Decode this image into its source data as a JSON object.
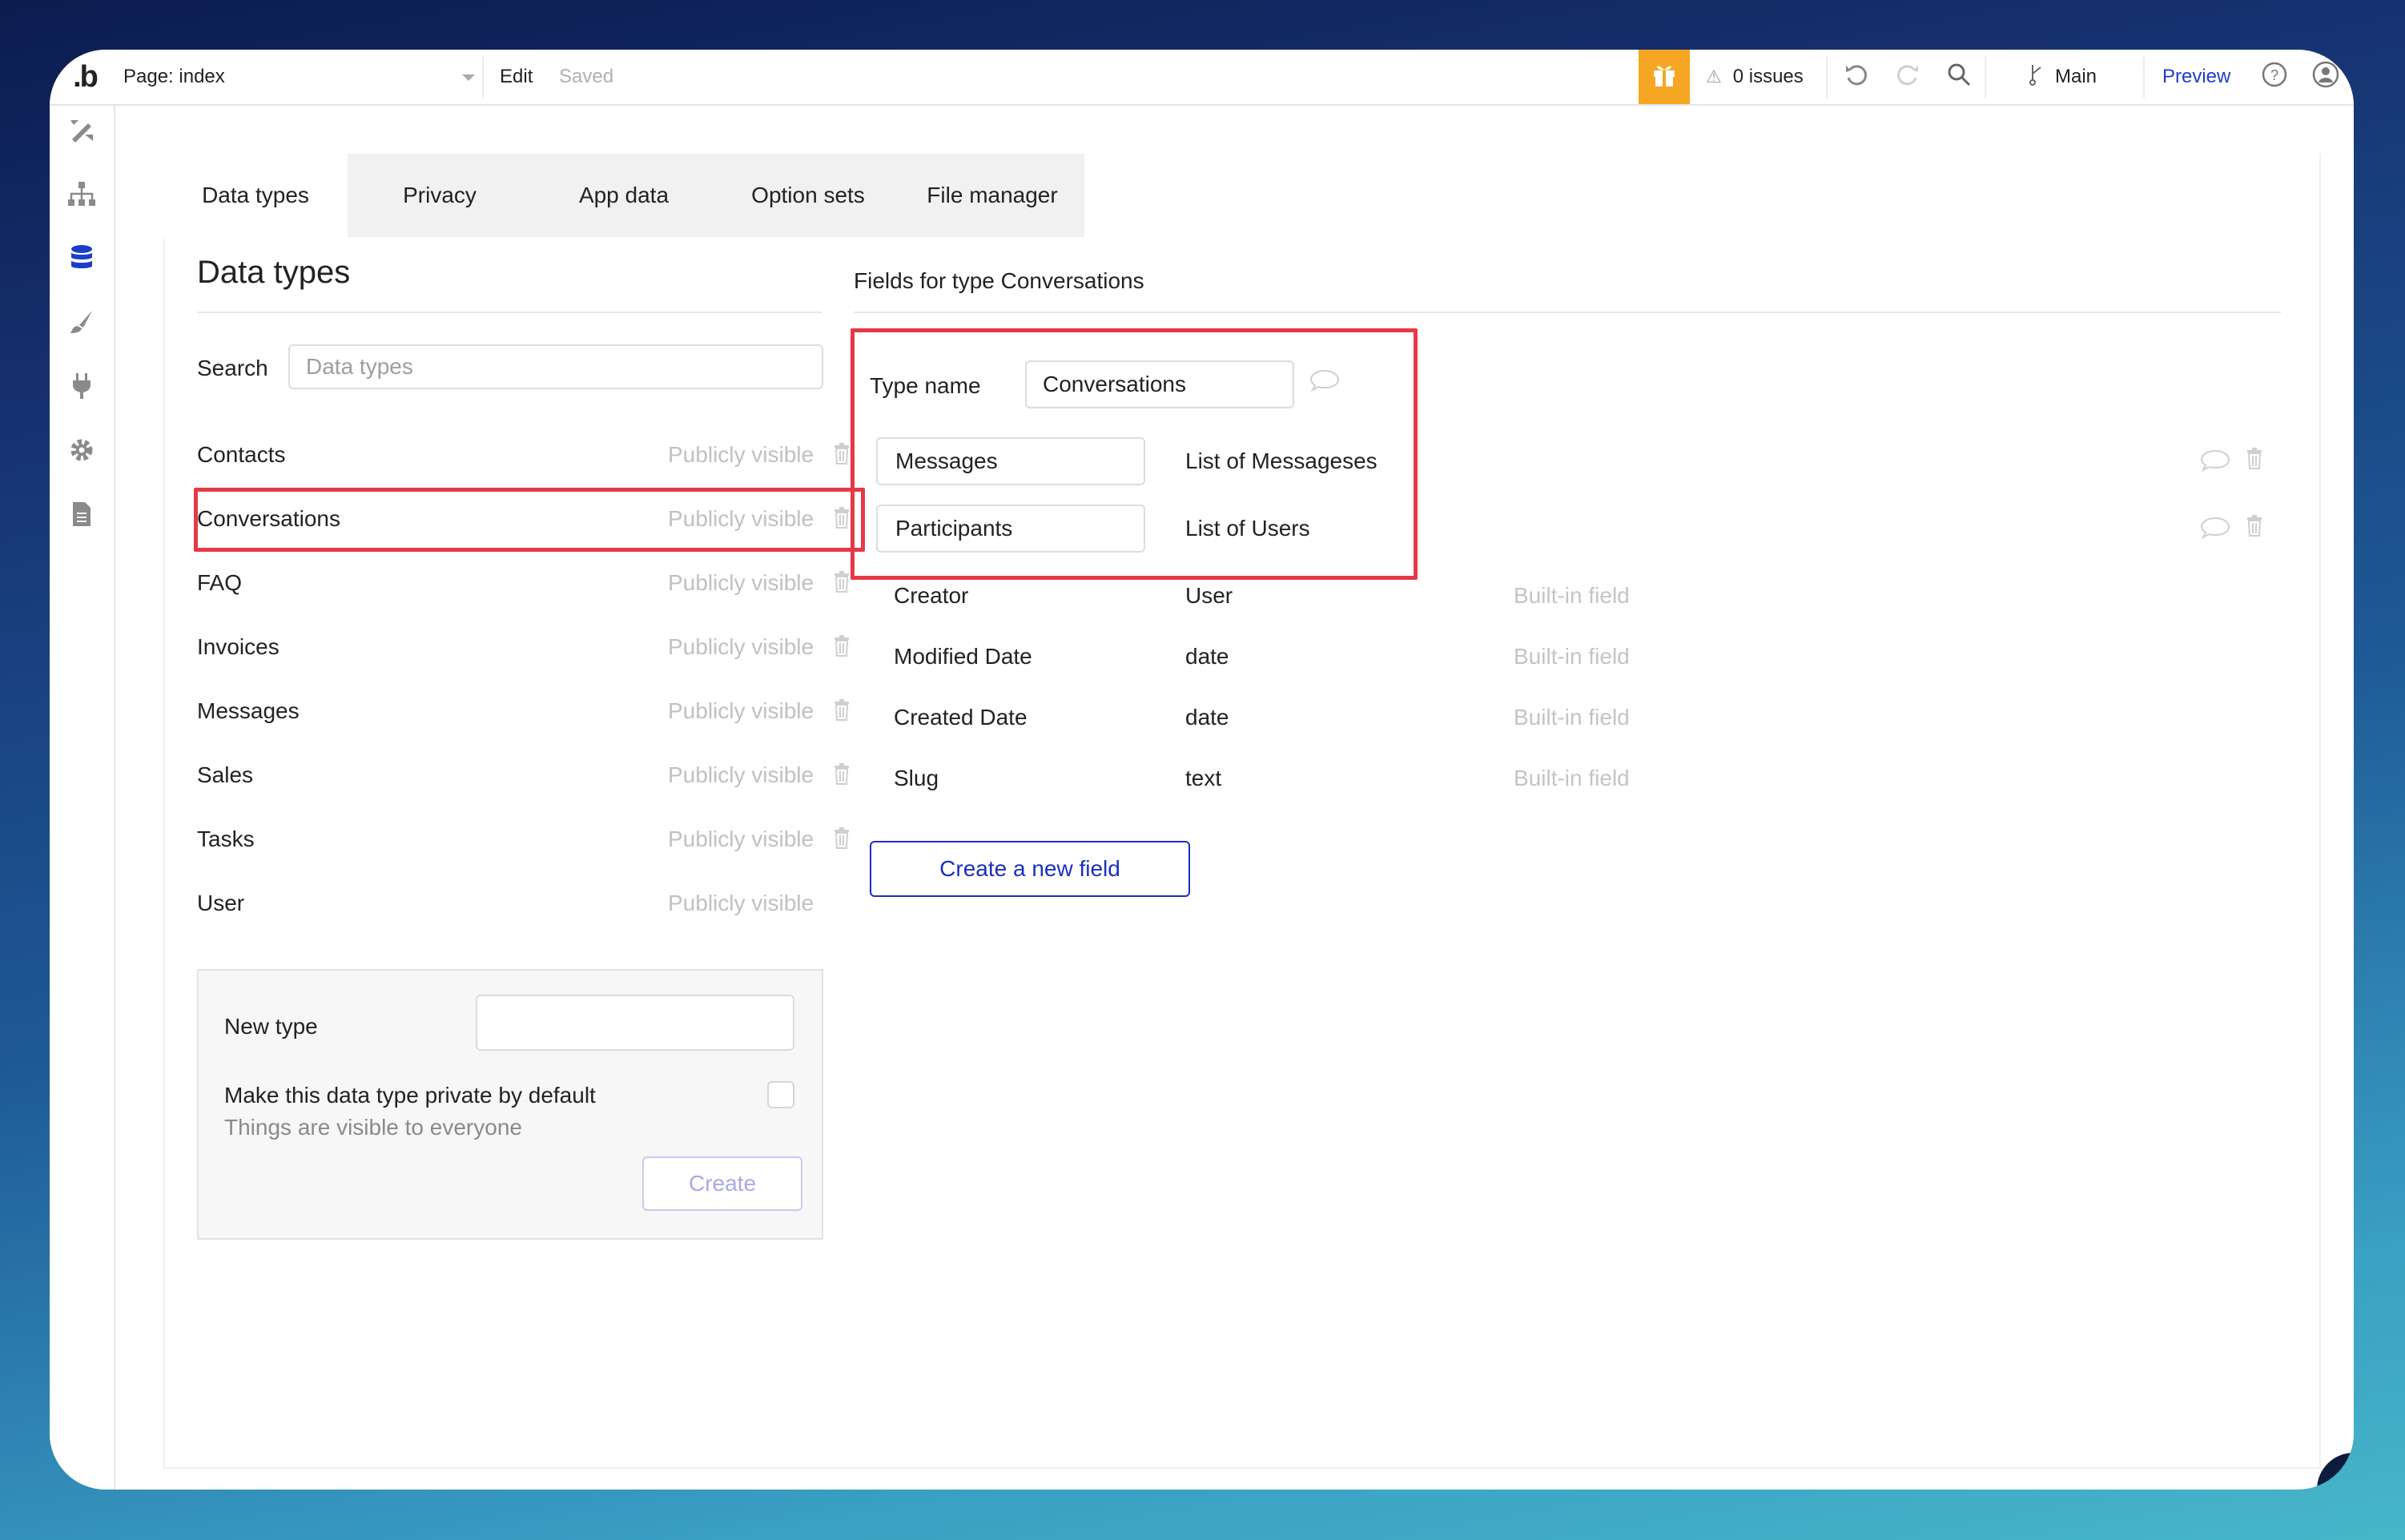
{
  "topbar": {
    "logo": ".b",
    "page_select": "Page: index",
    "edit": "Edit",
    "saved": "Saved",
    "issues": "0 issues",
    "branch": "Main",
    "preview": "Preview"
  },
  "sidebar": {
    "items": [
      "design-icon",
      "workflow-icon",
      "data-icon",
      "styles-icon",
      "plugins-icon",
      "settings-icon",
      "logs-icon"
    ],
    "active": "data-icon"
  },
  "tabs": [
    "Data types",
    "Privacy",
    "App data",
    "Option sets",
    "File manager"
  ],
  "data_types": {
    "title": "Data types",
    "search_label": "Search",
    "search_placeholder": "Data types",
    "items": [
      {
        "name": "Contacts",
        "visibility": "Publicly visible"
      },
      {
        "name": "Conversations",
        "visibility": "Publicly visible"
      },
      {
        "name": "FAQ",
        "visibility": "Publicly visible"
      },
      {
        "name": "Invoices",
        "visibility": "Publicly visible"
      },
      {
        "name": "Messages",
        "visibility": "Publicly visible"
      },
      {
        "name": "Sales",
        "visibility": "Publicly visible"
      },
      {
        "name": "Tasks",
        "visibility": "Publicly visible"
      },
      {
        "name": "User",
        "visibility": "Publicly visible"
      }
    ],
    "new_type": {
      "label": "New type",
      "private_label": "Make this data type private by default",
      "private_help": "Things are visible to everyone",
      "create": "Create"
    }
  },
  "fields": {
    "title": "Fields for type Conversations",
    "type_name_label": "Type name",
    "type_name": "Conversations",
    "custom": [
      {
        "name": "Messages",
        "type": "List of Messageses"
      },
      {
        "name": "Participants",
        "type": "List of Users"
      }
    ],
    "builtin": [
      {
        "name": "Creator",
        "type": "User",
        "note": "Built-in field"
      },
      {
        "name": "Modified Date",
        "type": "date",
        "note": "Built-in field"
      },
      {
        "name": "Created Date",
        "type": "date",
        "note": "Built-in field"
      },
      {
        "name": "Slug",
        "type": "text",
        "note": "Built-in field"
      }
    ],
    "create_button": "Create a new field"
  },
  "colors": {
    "accent": "#1a2fbf",
    "gift": "#f5a623",
    "highlight": "#e63946"
  }
}
